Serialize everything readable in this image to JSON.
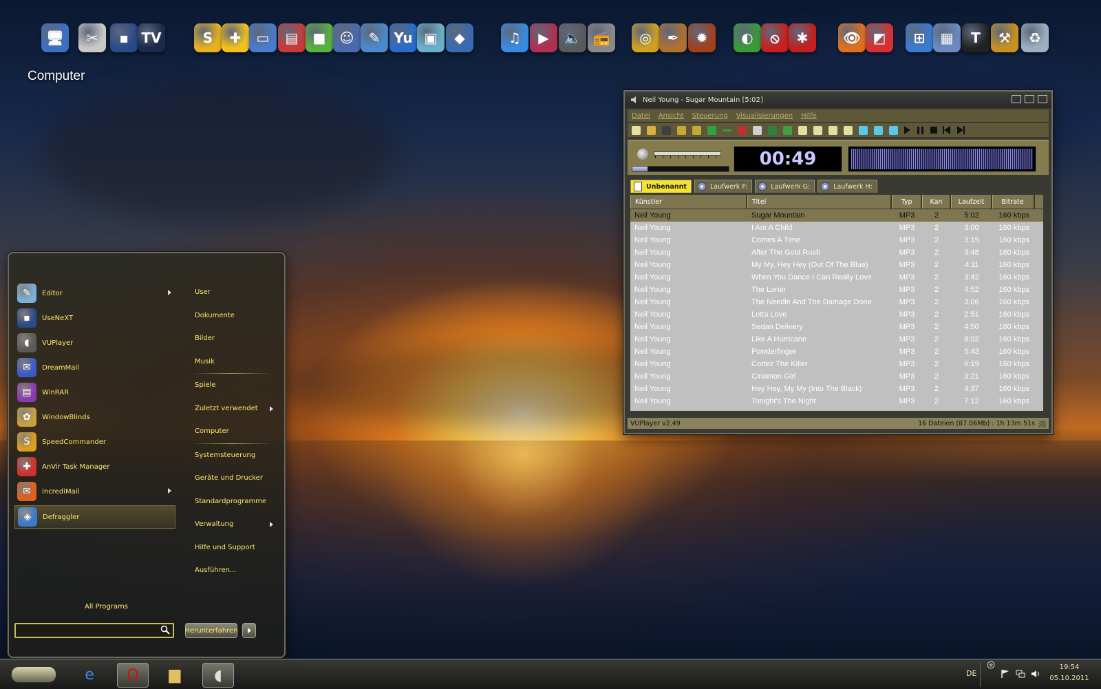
{
  "desktop": {
    "label": "Computer",
    "dock_icons": [
      {
        "name": "computer-icon",
        "glyph": "🖥",
        "color": "#3a6fc4"
      },
      {
        "name": "tools-icon",
        "glyph": "✂",
        "color": "#c8c8c8"
      },
      {
        "name": "usenext-icon",
        "glyph": "▪",
        "color": "#2a4a8a"
      },
      {
        "name": "tv-icon",
        "glyph": "TV",
        "color": "#1a2a4a"
      },
      {
        "name": "speedcommander-icon",
        "glyph": "S",
        "color": "#e8b020"
      },
      {
        "name": "puzzle-icon",
        "glyph": "✚",
        "color": "#f0c020"
      },
      {
        "name": "monitor-icon",
        "glyph": "▭",
        "color": "#4a7ac8"
      },
      {
        "name": "winrar-icon",
        "glyph": "▤",
        "color": "#c83a3a"
      },
      {
        "name": "cubes-icon",
        "glyph": "■",
        "color": "#5ab040"
      },
      {
        "name": "user-gear-icon",
        "glyph": "☺",
        "color": "#4a6ab0"
      },
      {
        "name": "drawing-icon",
        "glyph": "✎",
        "color": "#4a8ac8"
      },
      {
        "name": "yu-icon",
        "glyph": "Yu",
        "color": "#2a6ac8"
      },
      {
        "name": "screens-icon",
        "glyph": "▣",
        "color": "#6ab0c8"
      },
      {
        "name": "hat-icon",
        "glyph": "◆",
        "color": "#3a6ab0"
      },
      {
        "name": "itunes-icon",
        "glyph": "♫",
        "color": "#3a8ae0"
      },
      {
        "name": "play-icon",
        "glyph": "▶",
        "color": "#b03050"
      },
      {
        "name": "speaker-icon",
        "glyph": "🔈",
        "color": "#5a5a5a"
      },
      {
        "name": "radio-icon",
        "glyph": "📻",
        "color": "#8a8a8a"
      },
      {
        "name": "disc-burn-icon",
        "glyph": "◎",
        "color": "#d0a020"
      },
      {
        "name": "pen-icon",
        "glyph": "✒",
        "color": "#b07030"
      },
      {
        "name": "burner-icon",
        "glyph": "✹",
        "color": "#a04020"
      },
      {
        "name": "colorful-cd-icon",
        "glyph": "◐",
        "color": "#3a9a3a"
      },
      {
        "name": "no-entry-icon",
        "glyph": "⦸",
        "color": "#c82020"
      },
      {
        "name": "ladybug-icon",
        "glyph": "✱",
        "color": "#c02020"
      },
      {
        "name": "eye-icon",
        "glyph": "👁",
        "color": "#e07020"
      },
      {
        "name": "chart-icon",
        "glyph": "◩",
        "color": "#d83030"
      },
      {
        "name": "windows-icon",
        "glyph": "⊞",
        "color": "#3a7ad0"
      },
      {
        "name": "network-icon",
        "glyph": "▦",
        "color": "#6a8ac0"
      },
      {
        "name": "shirt-icon",
        "glyph": "T",
        "color": "#222222"
      },
      {
        "name": "hammer-icon",
        "glyph": "⚒",
        "color": "#c89020"
      },
      {
        "name": "recycle-bin-icon",
        "glyph": "♻",
        "color": "#9ab0c0"
      }
    ]
  },
  "start_menu": {
    "programs": [
      {
        "label": "Editor",
        "icon": "notepad-icon",
        "color": "#7ab0d8",
        "glyph": "✎",
        "submenu": true
      },
      {
        "label": "UseNeXT",
        "icon": "usenext-icon",
        "color": "#2a4a8a",
        "glyph": "▪",
        "submenu": false
      },
      {
        "label": "VUPlayer",
        "icon": "speaker-icon",
        "color": "#5a5a5a",
        "glyph": "◖",
        "submenu": false
      },
      {
        "label": "DreamMail",
        "icon": "dreammail-icon",
        "color": "#3a5ac8",
        "glyph": "✉",
        "submenu": false
      },
      {
        "label": "WinRAR",
        "icon": "winrar-icon",
        "color": "#8a3ab0",
        "glyph": "▤",
        "submenu": false
      },
      {
        "label": "WindowBlinds",
        "icon": "windowblinds-icon",
        "color": "#c8a040",
        "glyph": "✿",
        "submenu": false
      },
      {
        "label": "SpeedCommander",
        "icon": "speedcommander-icon",
        "color": "#d8a020",
        "glyph": "S",
        "submenu": false
      },
      {
        "label": "AnVir Task Manager",
        "icon": "anvir-icon",
        "color": "#d03030",
        "glyph": "✚",
        "submenu": false
      },
      {
        "label": "IncrediMail",
        "icon": "incredimail-icon",
        "color": "#e06020",
        "glyph": "✉",
        "submenu": true
      },
      {
        "label": "Defraggler",
        "icon": "defraggler-icon",
        "color": "#3a7ad0",
        "glyph": "◈",
        "submenu": false,
        "selected": true
      }
    ],
    "places": [
      {
        "label": "User",
        "submenu": false
      },
      {
        "label": "Dokumente",
        "submenu": false
      },
      {
        "label": "Bilder",
        "submenu": false
      },
      {
        "label": "Musik",
        "submenu": false,
        "sep_after": true
      },
      {
        "label": "Spiele",
        "submenu": false
      },
      {
        "label": "Zuletzt verwendet",
        "submenu": true
      },
      {
        "label": "Computer",
        "submenu": false,
        "sep_after": true
      },
      {
        "label": "Systemsteuerung",
        "submenu": false
      },
      {
        "label": "Geräte und Drucker",
        "submenu": false
      },
      {
        "label": "Standardprogramme",
        "submenu": false
      },
      {
        "label": "Verwaltung",
        "submenu": true
      },
      {
        "label": "Hilfe und Support",
        "submenu": false
      },
      {
        "label": "Ausführen...",
        "submenu": false
      }
    ],
    "all_programs": "All Programs",
    "search_value": "",
    "shutdown_label": "Herunterfahren"
  },
  "player": {
    "title": "Neil Young - Sugar Mountain [5:02]",
    "menu": [
      "Datei",
      "Ansicht",
      "Steuerung",
      "Visualisierungen",
      "Hilfe"
    ],
    "time": "00:49",
    "progress_fraction": 0.16,
    "tabs": [
      "Unbenannt",
      "Laufwerk F:",
      "Laufwerk G:",
      "Laufwerk H:"
    ],
    "columns": [
      "Künstler",
      "Titel",
      "Typ",
      "Kan",
      "Laufzeit",
      "Bitrate"
    ],
    "rows": [
      [
        "Neil Young",
        "Sugar Mountain",
        "MP3",
        "2",
        "5:02",
        "160 kbps"
      ],
      [
        "Neil Young",
        "I Am A Child",
        "MP3",
        "2",
        "3:00",
        "160 kbps"
      ],
      [
        "Neil Young",
        "Comes A Time",
        "MP3",
        "2",
        "3:15",
        "160 kbps"
      ],
      [
        "Neil Young",
        "After The Gold Rush",
        "MP3",
        "2",
        "3:48",
        "160 kbps"
      ],
      [
        "Neil Young",
        "My My, Hey Hey (Out Of The Blue)",
        "MP3",
        "2",
        "4:11",
        "160 kbps"
      ],
      [
        "Neil Young",
        "When You Dance I Can Really Love",
        "MP3",
        "2",
        "3:42",
        "160 kbps"
      ],
      [
        "Neil Young",
        "The Loner",
        "MP3",
        "2",
        "4:52",
        "160 kbps"
      ],
      [
        "Neil Young",
        "The Needle And The Damage Done",
        "MP3",
        "2",
        "3:06",
        "160 kbps"
      ],
      [
        "Neil Young",
        "Lotta Love",
        "MP3",
        "2",
        "2:51",
        "160 kbps"
      ],
      [
        "Neil Young",
        "Sedan Delivery",
        "MP3",
        "2",
        "4:50",
        "160 kbps"
      ],
      [
        "Neil Young",
        "Like A Hurricane",
        "MP3",
        "2",
        "8:02",
        "160 kbps"
      ],
      [
        "Neil Young",
        "Powderfinger",
        "MP3",
        "2",
        "5:43",
        "160 kbps"
      ],
      [
        "Neil Young",
        "Cortez The Killer",
        "MP3",
        "2",
        "6:19",
        "160 kbps"
      ],
      [
        "Neil Young",
        "Cinamon Girl",
        "MP3",
        "2",
        "3:21",
        "160 kbps"
      ],
      [
        "Neil Young",
        "Hey Hey, My My (Into The Black)",
        "MP3",
        "2",
        "4:37",
        "160 kbps"
      ],
      [
        "Neil Young",
        "Tonight's The Night",
        "MP3",
        "2",
        "7:12",
        "160 kbps"
      ]
    ],
    "status_left": "VUPlayer v2.49",
    "status_right": "16 Dateien (87.06Mb) : 1h 13m 51s"
  },
  "taskbar": {
    "apps": [
      {
        "name": "internet-explorer-icon",
        "glyph": "e",
        "color": "#3a8ae0",
        "active": false
      },
      {
        "name": "opera-icon",
        "glyph": "O",
        "color": "#d01010",
        "active": true
      },
      {
        "name": "file-explorer-icon",
        "glyph": "▆",
        "color": "#e0c060",
        "active": false
      },
      {
        "name": "vuplayer-taskbar-icon",
        "glyph": "◖",
        "color": "#e0e0e0",
        "active": true
      }
    ],
    "language": "DE",
    "time": "19:54",
    "date": "05.10.2011"
  }
}
